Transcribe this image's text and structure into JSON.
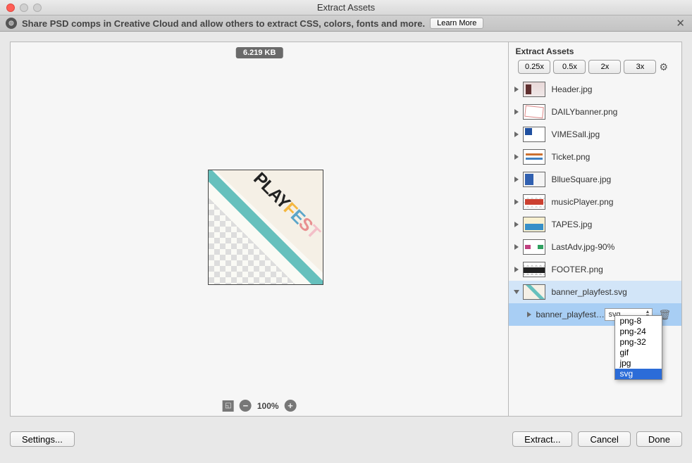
{
  "window": {
    "title": "Extract Assets"
  },
  "banner": {
    "text": "Share PSD comps in Creative Cloud and allow others to extract CSS, colors, fonts and more.",
    "learn_more": "Learn More"
  },
  "preview": {
    "size_label": "6.219 KB",
    "zoom": "100%",
    "logo_text": "PLAYFEST"
  },
  "assets": {
    "title": "Extract Assets",
    "scales": [
      "0.25x",
      "0.5x",
      "2x",
      "3x"
    ],
    "items": [
      {
        "name": "Header.jpg",
        "thumb": "th-header"
      },
      {
        "name": "DAILYbanner.png",
        "thumb": "th-daily"
      },
      {
        "name": "VIMESall.jpg",
        "thumb": "th-vimes"
      },
      {
        "name": "Ticket.png",
        "thumb": "th-ticket"
      },
      {
        "name": "BllueSquare.jpg",
        "thumb": "th-blue"
      },
      {
        "name": "musicPlayer.png",
        "thumb": "th-music"
      },
      {
        "name": "TAPES.jpg",
        "thumb": "th-tapes"
      },
      {
        "name": "LastAdv.jpg-90%",
        "thumb": "th-last"
      },
      {
        "name": "FOOTER.png",
        "thumb": "th-footer"
      }
    ],
    "selected": {
      "parent_name": "banner_playfest.svg",
      "child_name": "banner_playfest.svg",
      "format": "svg"
    },
    "format_options": [
      "png-8",
      "png-24",
      "png-32",
      "gif",
      "jpg",
      "svg"
    ]
  },
  "footer": {
    "settings": "Settings...",
    "extract": "Extract...",
    "cancel": "Cancel",
    "done": "Done"
  }
}
